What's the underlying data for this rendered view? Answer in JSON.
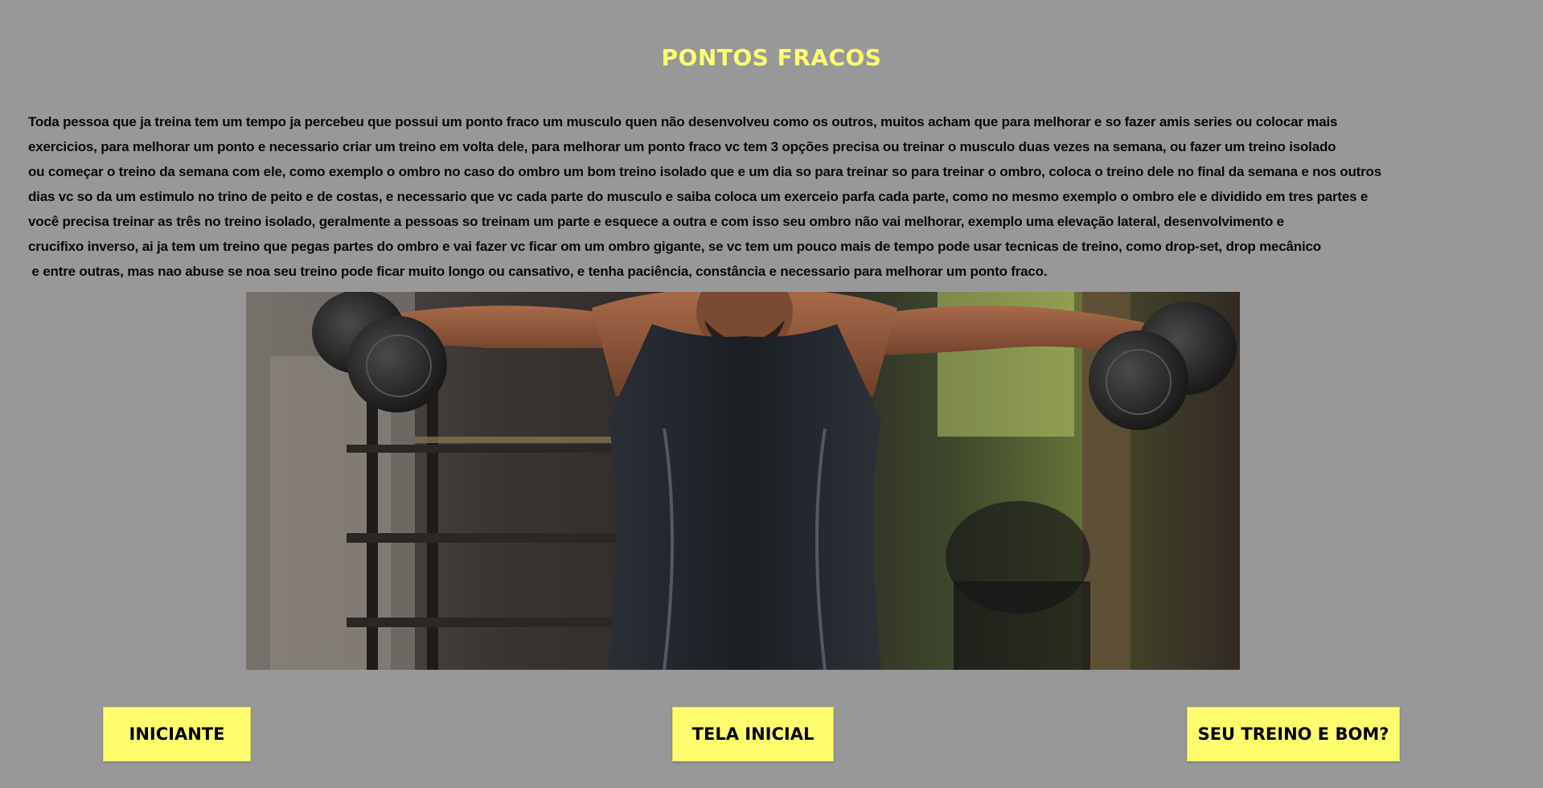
{
  "page": {
    "title": "PONTOS FRACOS"
  },
  "article": {
    "lines": [
      "Toda pessoa que ja treina tem um tempo ja percebeu que possui um ponto fraco um musculo quen não desenvolveu como os outros, muitos acham que para melhorar e so fazer amis series ou colocar mais",
      "exercicios, para melhorar um ponto e necessario criar um treino em volta dele, para melhorar um ponto fraco vc tem 3 opções precisa ou treinar o musculo duas vezes na semana, ou fazer um treino isolado",
      "ou começar o treino da semana com ele, como exemplo o ombro no caso do ombro um bom treino isolado que e um dia so para treinar so para treinar o ombro, coloca o treino dele no final da semana e nos outros",
      "dias vc so da um estimulo no trino de peito e de costas, e necessario que vc cada parte do musculo e saiba coloca um exerceio parfa cada parte, como no mesmo exemplo o ombro ele e dividido em tres partes e",
      "você precisa treinar as três no treino isolado, geralmente a pessoas so treinam um parte e esquece a outra e com isso seu ombro não vai melhorar, exemplo uma elevação lateral, desenvolvimento e",
      "crucifixo inverso, ai ja tem um treino que pegas partes do ombro e vai fazer vc ficar om um ombro gigante, se vc tem um pouco mais de tempo pode usar tecnicas de treino, como drop-set, drop mecânico",
      " e entre outras, mas nao abuse se noa seu treino pode ficar muito longo ou cansativo, e tenha paciência, constância e necessario para melhorar um ponto fraco."
    ]
  },
  "image": {
    "icon": "gym-photo-lateral-raise"
  },
  "nav": {
    "beginner_label": "INICIANTE",
    "home_label": "TELA INICIAL",
    "check_label": "SEU TREINO E BOM?"
  },
  "colors": {
    "background": "#989898",
    "accent": "#fdfd6e",
    "text": "#0a0a0a"
  }
}
